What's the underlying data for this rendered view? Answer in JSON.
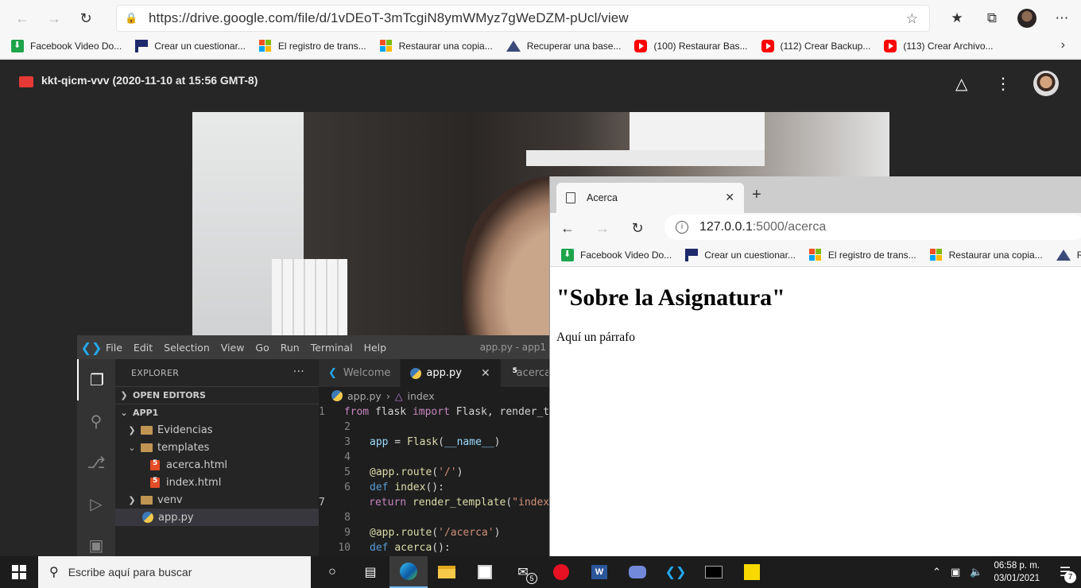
{
  "outer_browser": {
    "url": "https://drive.google.com/file/d/1vDEoT-3mTcgiN8ymWMyz7gWeDZM-pUcl/view",
    "bookmarks": [
      {
        "label": "Facebook Video Do...",
        "icon": "green-download"
      },
      {
        "label": "Crear un cuestionar...",
        "icon": "forms-flag"
      },
      {
        "label": "El registro de trans...",
        "icon": "microsoft-logo"
      },
      {
        "label": "Restaurar una copia...",
        "icon": "microsoft-logo"
      },
      {
        "label": "Recuperar una base...",
        "icon": "triangle-logo"
      },
      {
        "label": "(100) Restaurar Bas...",
        "icon": "youtube"
      },
      {
        "label": "(112) Crear Backup...",
        "icon": "youtube"
      },
      {
        "label": "(113) Crear Archivo...",
        "icon": "youtube"
      }
    ]
  },
  "drive": {
    "title": "kkt-qicm-vvv (2020-11-10 at 15:56 GMT-8)"
  },
  "vscode": {
    "menu": [
      "File",
      "Edit",
      "Selection",
      "View",
      "Go",
      "Run",
      "Terminal",
      "Help"
    ],
    "window_title": "app.py - app1",
    "explorer_title": "EXPLORER",
    "open_editors": "OPEN EDITORS",
    "project": "APP1",
    "tree": [
      {
        "label": "Evidencias",
        "type": "folder",
        "level": 1
      },
      {
        "label": "templates",
        "type": "folder-open",
        "level": 1
      },
      {
        "label": "acerca.html",
        "type": "html",
        "level": 2
      },
      {
        "label": "index.html",
        "type": "html",
        "level": 2
      },
      {
        "label": "venv",
        "type": "folder",
        "level": 1
      },
      {
        "label": "app.py",
        "type": "python",
        "level": 1
      }
    ],
    "tabs": [
      {
        "label": "Welcome"
      },
      {
        "label": "app.py"
      },
      {
        "label": "acerca.html"
      }
    ],
    "breadcrumb_file": "app.py",
    "breadcrumb_symbol": "index",
    "code_lines": [
      "from flask import Flask, render_template",
      "",
      "app = Flask(__name__)",
      "",
      "@app.route('/')",
      "def index():",
      "    return render_template(\"index.html\")",
      "",
      "@app.route('/acerca')",
      "def acerca():"
    ],
    "line_numbers": [
      "1",
      "2",
      "3",
      "4",
      "5",
      "6",
      "7",
      "8",
      "9",
      "10"
    ]
  },
  "inner_browser": {
    "tab_title": "Acerca",
    "url_host": "127.0.0.1",
    "url_path": ":5000/acerca",
    "bookmarks": [
      {
        "label": "Facebook Video Do..."
      },
      {
        "label": "Crear un cuestionar..."
      },
      {
        "label": "El registro de trans..."
      },
      {
        "label": "Restaurar una copia..."
      },
      {
        "label": "Re"
      }
    ],
    "heading": "\"Sobre la Asignatura\"",
    "paragraph": "Aquí un párrafo"
  },
  "taskbar": {
    "search_placeholder": "Escribe aquí para buscar",
    "mail_badge": "5",
    "time": "06:58 p. m.",
    "date": "03/01/2021",
    "notifications": "7"
  }
}
